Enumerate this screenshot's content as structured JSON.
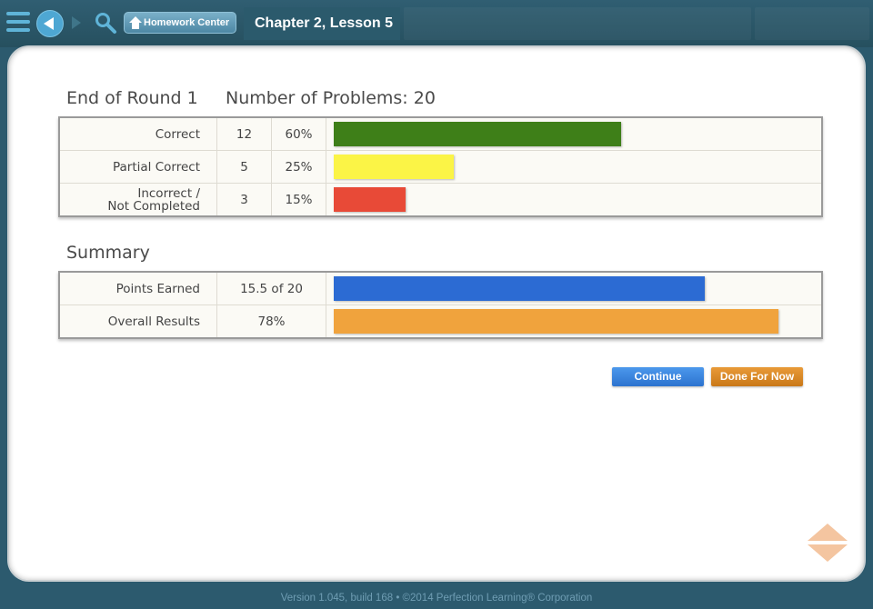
{
  "toolbar": {
    "home_label": "Homework Center",
    "page_title": "Chapter 2, Lesson 5"
  },
  "round": {
    "heading": "End of Round 1",
    "problems_heading": "Number of Problems: 20",
    "rows": [
      {
        "label": "Correct",
        "count": "12",
        "percent": "60%",
        "fraction": 0.6,
        "color": "#3e7f18"
      },
      {
        "label": "Partial Correct",
        "count": "5",
        "percent": "25%",
        "fraction": 0.25,
        "color": "#fbf446"
      },
      {
        "label_line1": "Incorrect /",
        "label_line2": "Not Completed",
        "count": "3",
        "percent": "15%",
        "fraction": 0.15,
        "color": "#e84a37"
      }
    ]
  },
  "summary": {
    "heading": "Summary",
    "rows": [
      {
        "label": "Points Earned",
        "value": "15.5 of 20",
        "fraction": 0.775,
        "color": "#2c6bd3"
      },
      {
        "label": "Overall Results",
        "value": "78%",
        "fraction": 0.93,
        "color": "#f0a33d"
      }
    ]
  },
  "buttons": {
    "continue": "Continue",
    "done": "Done For Now"
  },
  "footer": {
    "text": "Version 1.045, build 168  •  ©2014 Perfection Learning® Corporation"
  },
  "icons": [
    "menu-icon",
    "back-icon",
    "forward-icon",
    "search-icon",
    "home-icon",
    "scroll-arrows-icon"
  ]
}
